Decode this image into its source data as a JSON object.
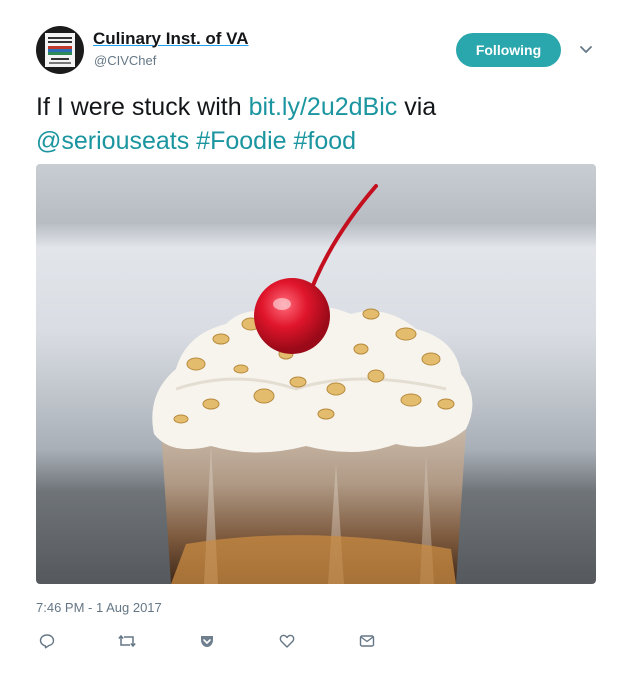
{
  "account": {
    "name": "Culinary Inst. of VA",
    "handle": "@CIVChef",
    "avatar_icon": "culinary-institute-logo"
  },
  "follow_button": {
    "label": "Following",
    "color": "#2aa6ad"
  },
  "tweet": {
    "text_plain_1": "If I were stuck with ",
    "link": "bit.ly/2u2dBic",
    "text_plain_2": " via",
    "mention": "@seriouseats",
    "hashtag_1": "#Foodie",
    "hashtag_2": "#food",
    "link_color": "#1b95a0"
  },
  "media": {
    "icon": "milkshake-photo",
    "alt": ""
  },
  "timestamp": "7:46 PM - 1 Aug 2017",
  "actions": [
    "reply-icon",
    "retweet-icon",
    "pocket-icon",
    "like-icon",
    "message-icon"
  ]
}
